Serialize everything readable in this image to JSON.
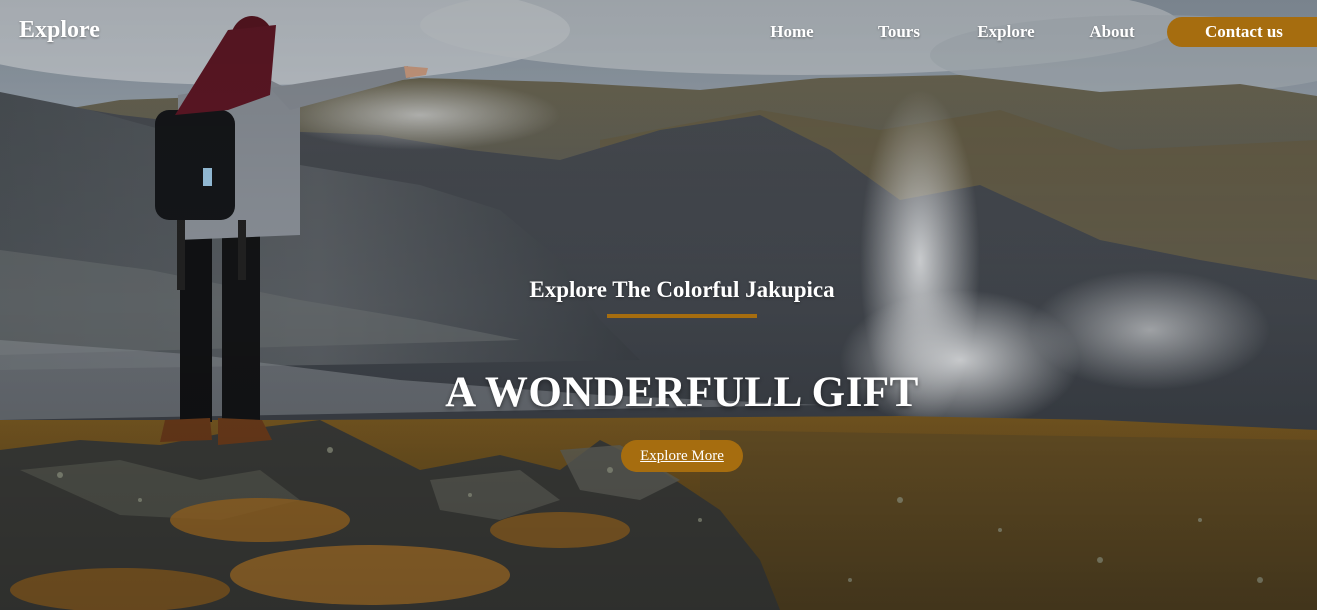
{
  "header": {
    "brand": "Explore",
    "nav": {
      "home": "Home",
      "tours": "Tours",
      "explore": "Explore",
      "about": "About",
      "contact": "Contact us"
    }
  },
  "hero": {
    "subtitle": "Explore The Colorful Jakupica",
    "headline": "A WONDERFULL GIFT",
    "cta_label": "Explore More"
  },
  "colors": {
    "accent": "#a66d0f",
    "text": "#ffffff"
  }
}
